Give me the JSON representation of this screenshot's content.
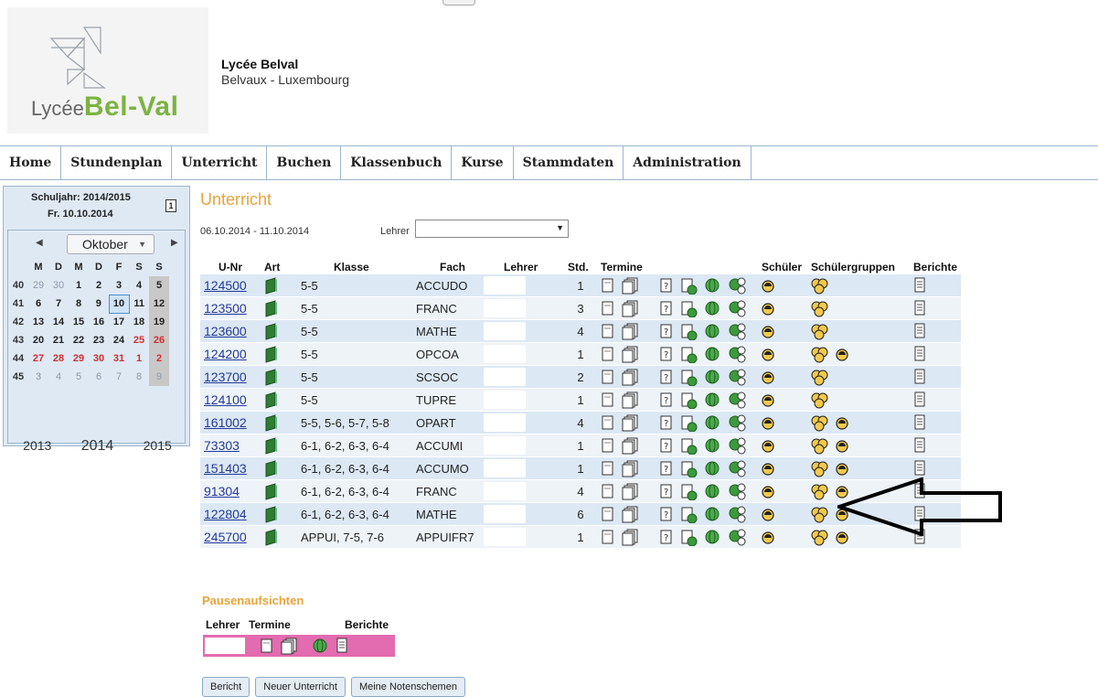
{
  "header": {
    "logo_small": "Lycée",
    "logo_big": "Bel-Val",
    "school_name": "Lycée Belval",
    "school_place": "Belvaux - Luxembourg"
  },
  "nav": [
    "Home",
    "Stundenplan",
    "Unterricht",
    "Buchen",
    "Klassenbuch",
    "Kurse",
    "Stammdaten",
    "Administration"
  ],
  "calendar": {
    "schuljahr": "Schuljahr: 2014/2015",
    "date": "Fr. 10.10.2014",
    "month": "Oktober",
    "weekday_headers": [
      "M",
      "D",
      "M",
      "D",
      "F",
      "S",
      "S"
    ],
    "weeks": [
      {
        "wk": "40",
        "days": [
          "29",
          "30",
          "1",
          "2",
          "3",
          "4",
          "5"
        ]
      },
      {
        "wk": "41",
        "days": [
          "6",
          "7",
          "8",
          "9",
          "10",
          "11",
          "12"
        ]
      },
      {
        "wk": "42",
        "days": [
          "13",
          "14",
          "15",
          "16",
          "17",
          "18",
          "19"
        ]
      },
      {
        "wk": "43",
        "days": [
          "20",
          "21",
          "22",
          "23",
          "24",
          "25",
          "26"
        ]
      },
      {
        "wk": "44",
        "days": [
          "27",
          "28",
          "29",
          "30",
          "31",
          "1",
          "2"
        ]
      },
      {
        "wk": "45",
        "days": [
          "3",
          "4",
          "5",
          "6",
          "7",
          "8",
          "9"
        ]
      }
    ],
    "years": [
      "2013",
      "2014",
      "2015"
    ]
  },
  "main": {
    "title": "Unterricht",
    "week_range": "06.10.2014 - 11.10.2014",
    "lehrer_label": "Lehrer"
  },
  "table": {
    "headers": {
      "unr": "U-Nr",
      "art": "Art",
      "klasse": "Klasse",
      "fach": "Fach",
      "lehrer": "Lehrer",
      "std": "Std.",
      "termine": "Termine",
      "schueler": "Schüler",
      "gruppen": "Schülergruppen",
      "berichte": "Berichte"
    },
    "rows": [
      {
        "unr": "124500",
        "klasse": "5-5",
        "fach": "ACCUDO",
        "std": "1",
        "extra_group": false
      },
      {
        "unr": "123500",
        "klasse": "5-5",
        "fach": "FRANC",
        "std": "3",
        "extra_group": false
      },
      {
        "unr": "123600",
        "klasse": "5-5",
        "fach": "MATHE",
        "std": "4",
        "extra_group": false
      },
      {
        "unr": "124200",
        "klasse": "5-5",
        "fach": "OPCOA",
        "std": "1",
        "extra_group": true
      },
      {
        "unr": "123700",
        "klasse": "5-5",
        "fach": "SCSOC",
        "std": "2",
        "extra_group": false
      },
      {
        "unr": "124100",
        "klasse": "5-5",
        "fach": "TUPRE",
        "std": "1",
        "extra_group": false
      },
      {
        "unr": "161002",
        "klasse": "5-5, 5-6, 5-7, 5-8",
        "fach": "OPART",
        "std": "4",
        "extra_group": true
      },
      {
        "unr": "73303",
        "klasse": "6-1, 6-2, 6-3, 6-4",
        "fach": "ACCUMI",
        "std": "1",
        "extra_group": true
      },
      {
        "unr": "151403",
        "klasse": "6-1, 6-2, 6-3, 6-4",
        "fach": "ACCUMO",
        "std": "1",
        "extra_group": true
      },
      {
        "unr": "91304",
        "klasse": "6-1, 6-2, 6-3, 6-4",
        "fach": "FRANC",
        "std": "4",
        "extra_group": true
      },
      {
        "unr": "122804",
        "klasse": "6-1, 6-2, 6-3, 6-4",
        "fach": "MATHE",
        "std": "6",
        "extra_group": true
      },
      {
        "unr": "245700",
        "klasse": "APPUI, 7-5, 7-6",
        "fach": "APPUIFR7",
        "std": "1",
        "extra_group": true
      }
    ]
  },
  "pause": {
    "title": "Pausenaufsichten",
    "lehrer": "Lehrer",
    "termine": "Termine",
    "berichte": "Berichte"
  },
  "buttons": {
    "bericht": "Bericht",
    "neuer": "Neuer Unterricht",
    "noten": "Meine Notenschemen"
  },
  "colors": {
    "accent_orange": "#e8a33a",
    "row_blue": "#dce8f4",
    "pause_pink": "#e36bb0",
    "link_blue": "#223a9a"
  }
}
